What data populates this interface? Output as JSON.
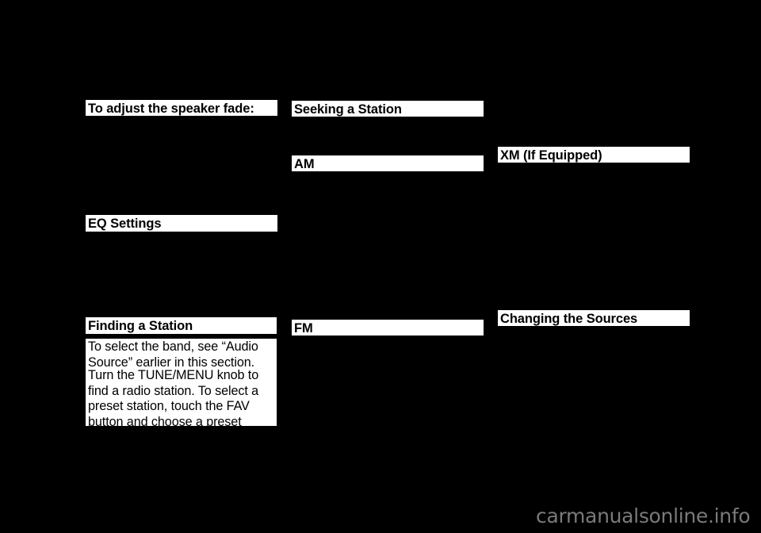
{
  "page": {
    "background_color": "#000000",
    "text_block_background": "#ffffff",
    "text_color": "#000000",
    "watermark": "carmanualsonline.info",
    "watermark_color": "#7a7a7a"
  },
  "columns": {
    "left": {
      "blocks": [
        {
          "id": "speaker-fade-heading",
          "kind": "heading",
          "text": "To adjust the speaker fade:"
        },
        {
          "id": "eq-settings-heading",
          "kind": "heading",
          "text": "EQ Settings"
        },
        {
          "id": "finding-a-station-heading",
          "kind": "heading",
          "text": "Finding a Station"
        },
        {
          "id": "finding-a-station-para-1",
          "kind": "body",
          "text": "To select the band, see “Audio Source” earlier in this section."
        },
        {
          "id": "finding-a-station-para-2",
          "kind": "body",
          "text": "Turn the TUNE/MENU knob to find a radio station. To select a preset station, touch the FAV button and choose a preset button."
        }
      ]
    },
    "middle": {
      "blocks": [
        {
          "id": "seeking-a-station-heading",
          "kind": "heading",
          "text": "Seeking a Station"
        },
        {
          "id": "am-heading",
          "kind": "heading",
          "text": "AM"
        },
        {
          "id": "fm-heading",
          "kind": "heading",
          "text": "FM"
        }
      ]
    },
    "right": {
      "blocks": [
        {
          "id": "xm-heading",
          "kind": "heading",
          "text": "XM (If Equipped)"
        },
        {
          "id": "changing-the-sources-heading",
          "kind": "heading",
          "text": "Changing the Sources"
        }
      ]
    }
  }
}
